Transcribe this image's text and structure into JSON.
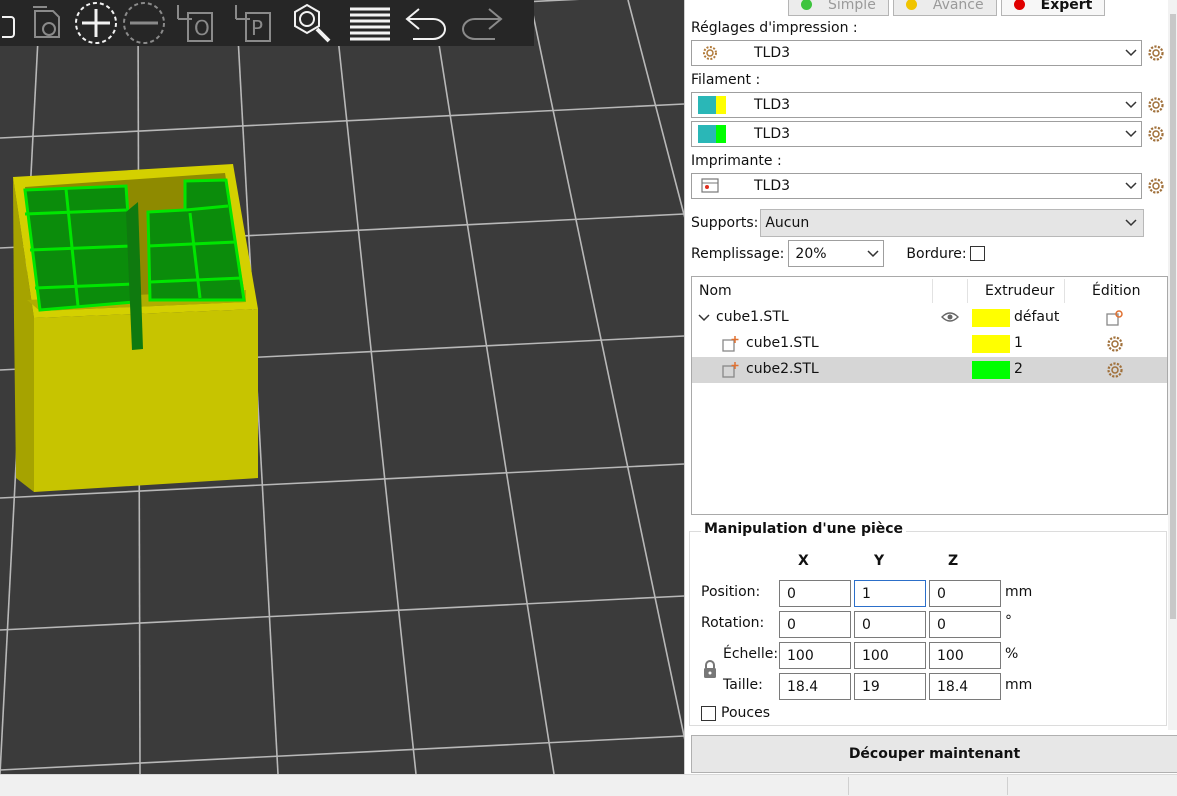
{
  "colors": {
    "viewport_bg": "#3b3b3b",
    "toolbar_bg": "#262626",
    "grid": "#b8b8b8",
    "model_yellow": "#c7c400",
    "model_green": "#00d700",
    "extruder_1": "#ffff00",
    "extruder_2": "#00ff00",
    "filament_teal": "#2ab7b7",
    "mode_simple": "#3ec43e",
    "mode_advanced": "#f0c400",
    "mode_expert": "#e00000"
  },
  "toolbar": {
    "icons": [
      "delete-icon",
      "delete-all-icon",
      "add-instance-icon",
      "remove-instance-icon",
      "split-objects-icon",
      "split-parts-icon",
      "search-icon",
      "layers-icon",
      "undo-icon",
      "redo-icon"
    ]
  },
  "modes": {
    "simple": "Simple",
    "advanced": "Avancé",
    "expert": "Expert"
  },
  "print_settings": {
    "label": "Réglages d'impression :",
    "value": "TLD3"
  },
  "filament": {
    "label": "Filament :",
    "slots": [
      {
        "value": "TLD3",
        "color_a": "#2ab7b7",
        "color_b": "#ffff00"
      },
      {
        "value": "TLD3",
        "color_a": "#2ab7b7",
        "color_b": "#00ff00"
      }
    ]
  },
  "printer": {
    "label": "Imprimante :",
    "value": "TLD3"
  },
  "supports": {
    "label": "Supports:",
    "value": "Aucun"
  },
  "infill": {
    "label": "Remplissage:",
    "value": "20%"
  },
  "brim": {
    "label": "Bordure:",
    "checked": false
  },
  "object_list": {
    "columns": {
      "name": "Nom",
      "extruder": "Extrudeur",
      "edit": "Édition"
    },
    "rows": [
      {
        "name": "cube1.STL",
        "extruder": "défaut",
        "color": "#ffff00",
        "level": 0,
        "selected": false
      },
      {
        "name": "cube1.STL",
        "extruder": "1",
        "color": "#ffff00",
        "level": 1,
        "selected": false
      },
      {
        "name": "cube2.STL",
        "extruder": "2",
        "color": "#00ff00",
        "level": 1,
        "selected": true
      }
    ]
  },
  "manipulation": {
    "title": "Manipulation d'une pièce",
    "axes": [
      "X",
      "Y",
      "Z"
    ],
    "position": {
      "label": "Position:",
      "x": "0",
      "y": "1",
      "z": "0",
      "unit": "mm"
    },
    "rotation": {
      "label": "Rotation:",
      "x": "0",
      "y": "0",
      "z": "0",
      "unit": "°"
    },
    "scale": {
      "label": "Échelle:",
      "x": "100",
      "y": "100",
      "z": "100",
      "unit": "%"
    },
    "size": {
      "label": "Taille:",
      "x": "18.4",
      "y": "19",
      "z": "18.4",
      "unit": "mm"
    },
    "inches_label": "Pouces",
    "inches_checked": false
  },
  "slice_button": "Découper maintenant"
}
